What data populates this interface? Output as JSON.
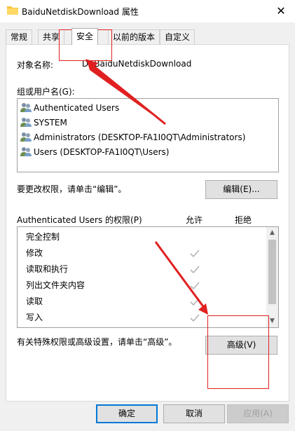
{
  "window": {
    "title": "BaiduNetdiskDownload 属性",
    "close_glyph": "✕",
    "folder_icon": "folder-icon"
  },
  "tabs": [
    {
      "label": "常规",
      "active": false
    },
    {
      "label": "共享",
      "active": false
    },
    {
      "label": "安全",
      "active": true
    },
    {
      "label": "以前的版本",
      "active": false
    },
    {
      "label": "自定义",
      "active": false
    }
  ],
  "object": {
    "label": "对象名称:",
    "value": "D:\\BaiduNetdiskDownload"
  },
  "groups": {
    "label": "组或用户名(G):",
    "items": [
      "Authenticated Users",
      "SYSTEM",
      "Administrators (DESKTOP-FA1I0QT\\Administrators)",
      "Users (DESKTOP-FA1I0QT\\Users)"
    ]
  },
  "edit": {
    "hint": "要更改权限，请单击“编辑”。",
    "button": "编辑(E)..."
  },
  "permissions": {
    "title": "Authenticated Users 的权限(P)",
    "allow_header": "允许",
    "deny_header": "拒绝",
    "rows": [
      {
        "name": "完全控制",
        "allow": false
      },
      {
        "name": "修改",
        "allow": true
      },
      {
        "name": "读取和执行",
        "allow": true
      },
      {
        "name": "列出文件夹内容",
        "allow": true
      },
      {
        "name": "读取",
        "allow": true
      },
      {
        "name": "写入",
        "allow": true
      }
    ]
  },
  "advanced": {
    "hint": "有关特殊权限或高级设置，请单击“高级”。",
    "button": "高级(V)"
  },
  "footer": {
    "ok": "确定",
    "cancel": "取消",
    "apply": "应用(A)"
  },
  "colors": {
    "annotation": "#e02020",
    "check_disabled": "#b4b4b4",
    "ok_border": "#0078d7"
  }
}
